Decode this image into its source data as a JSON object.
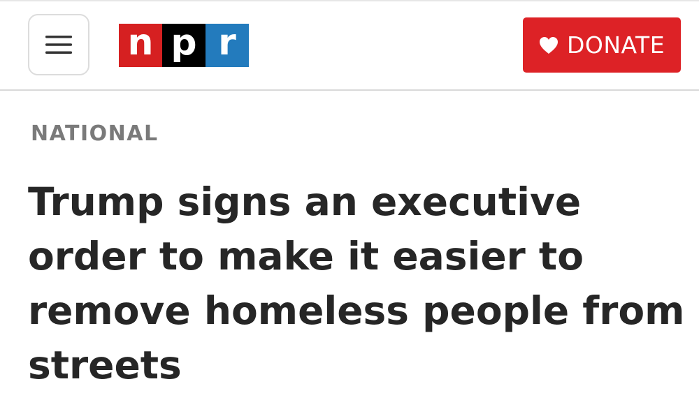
{
  "header": {
    "menu_icon": "hamburger-menu-icon",
    "logo": {
      "letters": [
        "n",
        "p",
        "r"
      ],
      "colors": [
        "#d62021",
        "#000000",
        "#237bbd"
      ]
    },
    "donate": {
      "icon": "heart-icon",
      "label": "DONATE",
      "color": "#dd2226"
    }
  },
  "article": {
    "section": "NATIONAL",
    "headline": "Trump signs an executive order to make it easier to remove homeless people from streets"
  }
}
